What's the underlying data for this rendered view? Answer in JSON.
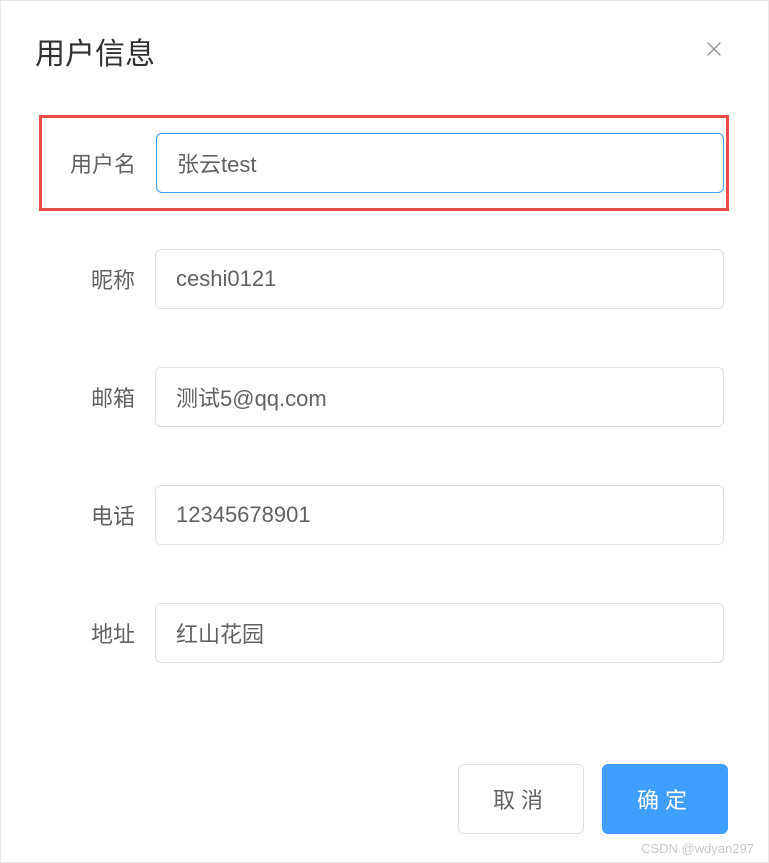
{
  "dialog": {
    "title": "用户信息"
  },
  "form": {
    "username": {
      "label": "用户名",
      "value": "张云test"
    },
    "nickname": {
      "label": "昵称",
      "value": "ceshi0121"
    },
    "email": {
      "label": "邮箱",
      "value": "测试5@qq.com"
    },
    "phone": {
      "label": "电话",
      "value": "12345678901"
    },
    "address": {
      "label": "地址",
      "value": "红山花园"
    }
  },
  "footer": {
    "cancel_label": "取消",
    "confirm_label": "确定"
  },
  "watermark": "CSDN @wdyan297"
}
